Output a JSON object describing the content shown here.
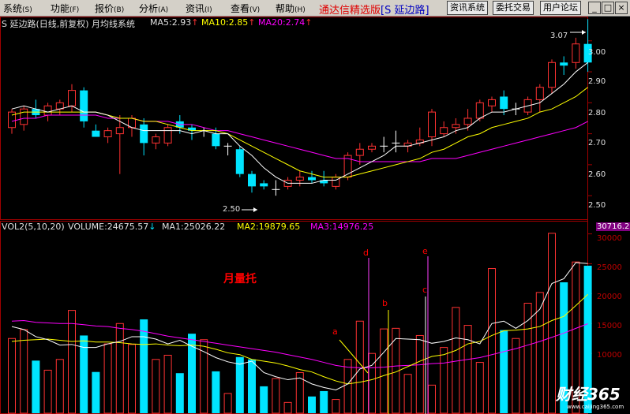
{
  "menu": {
    "items": [
      {
        "label": "系统",
        "arrow": "(S)"
      },
      {
        "label": "功能",
        "arrow": "(F)"
      },
      {
        "label": "报价",
        "arrow": "(B)"
      },
      {
        "label": "分析",
        "arrow": "(A)"
      },
      {
        "label": "资讯",
        "arrow": "(I)"
      },
      {
        "label": "查看",
        "arrow": "(V)"
      },
      {
        "label": "帮助",
        "arrow": "(H)"
      }
    ],
    "app_title": "通达信精选版",
    "stock_tag": "[S 延边路]",
    "buttons": [
      "资讯系统",
      "委托交易",
      "用户论坛"
    ],
    "window_controls": [
      "_",
      "□",
      "×"
    ]
  },
  "price_panel": {
    "title": "S 延边路(日线,前复权) 月均线系统",
    "ma5": "MA5:2.93",
    "ma10": "MA10:2.85",
    "ma20": "MA20:2.74",
    "up_arrow": "↑",
    "axis_labels": [
      "3.00",
      "2.90",
      "2.80",
      "2.70",
      "2.60",
      "2.50"
    ],
    "high_marker": "3.07",
    "low_marker": "2.50"
  },
  "volume_panel": {
    "title": "VOL2(5,10,20)",
    "volume": "VOLUME:24675.57",
    "ma1": "MA1:25026.22",
    "ma2": "MA2:19879.65",
    "ma3": "MA3:14976.25",
    "down_arrow": "↓",
    "top_value": "30716.2",
    "axis_labels": [
      "30000",
      "25000",
      "20000",
      "15000",
      "10000"
    ],
    "annotations": {
      "a": "a",
      "b": "b",
      "c": "c",
      "d": "d",
      "e": "e"
    },
    "caption": "月量托"
  },
  "watermark": {
    "text": "财经365",
    "url": "www.caijing365.com"
  },
  "colors": {
    "up": "#ff3232",
    "down": "#00e4ff",
    "ma5": "#ffffff",
    "ma10": "#ffff00",
    "ma20": "#ff00ff",
    "menu_bg": "#d4d0c8"
  },
  "chart_data": {
    "type": "candlestick",
    "price_range": [
      2.47,
      3.08
    ],
    "candles": [
      {
        "o": 2.72,
        "h": 2.78,
        "l": 2.7,
        "c": 2.77
      },
      {
        "o": 2.73,
        "h": 2.79,
        "l": 2.71,
        "c": 2.78
      },
      {
        "o": 2.78,
        "h": 2.81,
        "l": 2.75,
        "c": 2.76
      },
      {
        "o": 2.76,
        "h": 2.8,
        "l": 2.74,
        "c": 2.79
      },
      {
        "o": 2.78,
        "h": 2.81,
        "l": 2.76,
        "c": 2.8
      },
      {
        "o": 2.79,
        "h": 2.86,
        "l": 2.77,
        "c": 2.84
      },
      {
        "o": 2.84,
        "h": 2.85,
        "l": 2.72,
        "c": 2.74
      },
      {
        "o": 2.71,
        "h": 2.73,
        "l": 2.69,
        "c": 2.69
      },
      {
        "o": 2.69,
        "h": 2.72,
        "l": 2.67,
        "c": 2.71
      },
      {
        "o": 2.7,
        "h": 2.76,
        "l": 2.57,
        "c": 2.72
      },
      {
        "o": 2.72,
        "h": 2.76,
        "l": 2.69,
        "c": 2.75
      },
      {
        "o": 2.73,
        "h": 2.75,
        "l": 2.63,
        "c": 2.67
      },
      {
        "o": 2.67,
        "h": 2.7,
        "l": 2.65,
        "c": 2.69
      },
      {
        "o": 2.67,
        "h": 2.73,
        "l": 2.66,
        "c": 2.72
      },
      {
        "o": 2.74,
        "h": 2.76,
        "l": 2.7,
        "c": 2.72
      },
      {
        "o": 2.72,
        "h": 2.73,
        "l": 2.68,
        "c": 2.71
      },
      {
        "o": 2.71,
        "h": 2.72,
        "l": 2.69,
        "c": 2.71
      },
      {
        "o": 2.7,
        "h": 2.72,
        "l": 2.65,
        "c": 2.66
      },
      {
        "o": 2.66,
        "h": 2.67,
        "l": 2.63,
        "c": 2.66
      },
      {
        "o": 2.65,
        "h": 2.66,
        "l": 2.56,
        "c": 2.57
      },
      {
        "o": 2.57,
        "h": 2.58,
        "l": 2.51,
        "c": 2.53
      },
      {
        "o": 2.54,
        "h": 2.55,
        "l": 2.52,
        "c": 2.53
      },
      {
        "o": 2.52,
        "h": 2.55,
        "l": 2.5,
        "c": 2.52
      },
      {
        "o": 2.53,
        "h": 2.56,
        "l": 2.52,
        "c": 2.55
      },
      {
        "o": 2.55,
        "h": 2.58,
        "l": 2.53,
        "c": 2.56
      },
      {
        "o": 2.56,
        "h": 2.58,
        "l": 2.54,
        "c": 2.55
      },
      {
        "o": 2.55,
        "h": 2.58,
        "l": 2.53,
        "c": 2.54
      },
      {
        "o": 2.53,
        "h": 2.57,
        "l": 2.52,
        "c": 2.56
      },
      {
        "o": 2.56,
        "h": 2.64,
        "l": 2.55,
        "c": 2.63
      },
      {
        "o": 2.63,
        "h": 2.67,
        "l": 2.6,
        "c": 2.65
      },
      {
        "o": 2.65,
        "h": 2.67,
        "l": 2.64,
        "c": 2.66
      },
      {
        "o": 2.66,
        "h": 2.69,
        "l": 2.64,
        "c": 2.66
      },
      {
        "o": 2.67,
        "h": 2.71,
        "l": 2.64,
        "c": 2.67
      },
      {
        "o": 2.66,
        "h": 2.68,
        "l": 2.64,
        "c": 2.67
      },
      {
        "o": 2.67,
        "h": 2.72,
        "l": 2.66,
        "c": 2.68
      },
      {
        "o": 2.69,
        "h": 2.78,
        "l": 2.66,
        "c": 2.77
      },
      {
        "o": 2.7,
        "h": 2.74,
        "l": 2.69,
        "c": 2.72
      },
      {
        "o": 2.72,
        "h": 2.75,
        "l": 2.7,
        "c": 2.73
      },
      {
        "o": 2.73,
        "h": 2.78,
        "l": 2.71,
        "c": 2.75
      },
      {
        "o": 2.75,
        "h": 2.81,
        "l": 2.74,
        "c": 2.8
      },
      {
        "o": 2.79,
        "h": 2.82,
        "l": 2.77,
        "c": 2.81
      },
      {
        "o": 2.82,
        "h": 2.84,
        "l": 2.76,
        "c": 2.78
      },
      {
        "o": 2.78,
        "h": 2.8,
        "l": 2.76,
        "c": 2.78
      },
      {
        "o": 2.77,
        "h": 2.82,
        "l": 2.76,
        "c": 2.81
      },
      {
        "o": 2.81,
        "h": 2.86,
        "l": 2.77,
        "c": 2.85
      },
      {
        "o": 2.85,
        "h": 2.94,
        "l": 2.83,
        "c": 2.93
      },
      {
        "o": 2.93,
        "h": 2.95,
        "l": 2.89,
        "c": 2.92
      },
      {
        "o": 2.93,
        "h": 3.01,
        "l": 2.91,
        "c": 2.99
      },
      {
        "o": 2.99,
        "h": 3.07,
        "l": 2.9,
        "c": 2.93
      }
    ],
    "volumes": [
      12500,
      14000,
      8800,
      7200,
      9000,
      17200,
      13000,
      6900,
      11600,
      15000,
      11500,
      15700,
      9000,
      9700,
      6700,
      13300,
      12300,
      7000,
      3300,
      9400,
      9000,
      4500,
      5800,
      1800,
      6800,
      2800,
      3700,
      2300,
      9000,
      15400,
      10000,
      14100,
      14200,
      6500,
      13000,
      4700,
      11000,
      17700,
      14700,
      8500,
      24200,
      13900,
      12500,
      18400,
      20200,
      30100,
      21900,
      25300,
      24675
    ],
    "ma5": [
      2.78,
      2.79,
      2.78,
      2.77,
      2.78,
      2.79,
      2.77,
      2.77,
      2.76,
      2.74,
      2.72,
      2.71,
      2.71,
      2.71,
      2.71,
      2.7,
      2.71,
      2.7,
      2.7,
      2.66,
      2.63,
      2.59,
      2.56,
      2.54,
      2.54,
      2.54,
      2.55,
      2.55,
      2.57,
      2.59,
      2.61,
      2.63,
      2.66,
      2.66,
      2.67,
      2.68,
      2.69,
      2.71,
      2.72,
      2.75,
      2.77,
      2.77,
      2.78,
      2.79,
      2.8,
      2.83,
      2.86,
      2.9,
      2.93
    ],
    "ma10": [
      2.76,
      2.77,
      2.77,
      2.77,
      2.77,
      2.77,
      2.77,
      2.77,
      2.76,
      2.75,
      2.75,
      2.74,
      2.74,
      2.73,
      2.72,
      2.71,
      2.71,
      2.71,
      2.7,
      2.68,
      2.66,
      2.64,
      2.62,
      2.6,
      2.58,
      2.57,
      2.56,
      2.56,
      2.56,
      2.57,
      2.58,
      2.59,
      2.6,
      2.61,
      2.62,
      2.64,
      2.65,
      2.67,
      2.69,
      2.7,
      2.72,
      2.73,
      2.74,
      2.75,
      2.77,
      2.78,
      2.8,
      2.82,
      2.85
    ],
    "ma20": [
      2.74,
      2.75,
      2.75,
      2.76,
      2.76,
      2.76,
      2.76,
      2.76,
      2.75,
      2.75,
      2.75,
      2.74,
      2.74,
      2.74,
      2.73,
      2.73,
      2.72,
      2.71,
      2.71,
      2.7,
      2.69,
      2.68,
      2.67,
      2.66,
      2.65,
      2.64,
      2.63,
      2.62,
      2.62,
      2.61,
      2.61,
      2.61,
      2.61,
      2.61,
      2.61,
      2.62,
      2.62,
      2.62,
      2.63,
      2.64,
      2.65,
      2.66,
      2.67,
      2.68,
      2.69,
      2.7,
      2.71,
      2.72,
      2.74
    ],
    "vol_ma1": [
      14500,
      14000,
      12800,
      12300,
      11400,
      11500,
      11000,
      11000,
      11600,
      12000,
      12800,
      12800,
      12400,
      11600,
      12200,
      11200,
      10300,
      9300,
      8600,
      8200,
      8700,
      6800,
      6100,
      5600,
      5900,
      4900,
      4300,
      3900,
      4900,
      7400,
      8000,
      10200,
      12500,
      12400,
      12300,
      11700,
      12000,
      12600,
      12300,
      11600,
      15000,
      15400,
      14200,
      15500,
      17400,
      21700,
      22500,
      25200,
      25026
    ],
    "vol_ma2": [
      12000,
      12200,
      12300,
      12400,
      12200,
      12000,
      12100,
      11900,
      11900,
      11800,
      11600,
      11500,
      11600,
      11400,
      11300,
      11400,
      11200,
      10700,
      10100,
      9800,
      9000,
      8700,
      8400,
      7900,
      7300,
      6900,
      6100,
      5400,
      4900,
      5200,
      5600,
      6300,
      6900,
      7800,
      8700,
      9500,
      9800,
      10500,
      11600,
      12000,
      13000,
      13800,
      13900,
      14100,
      14500,
      15500,
      16200,
      18000,
      19880
    ],
    "vol_ma3": [
      15400,
      15500,
      15200,
      15100,
      15000,
      15000,
      14800,
      14600,
      14500,
      14200,
      14000,
      13700,
      13300,
      12900,
      12600,
      12300,
      12000,
      11700,
      11400,
      11100,
      10800,
      10500,
      10200,
      9800,
      9400,
      9000,
      8500,
      8000,
      7700,
      7600,
      7600,
      7700,
      7900,
      8000,
      8100,
      8300,
      8400,
      8700,
      9000,
      9300,
      9800,
      10300,
      10800,
      11400,
      12000,
      12700,
      13400,
      14200,
      14976
    ]
  }
}
